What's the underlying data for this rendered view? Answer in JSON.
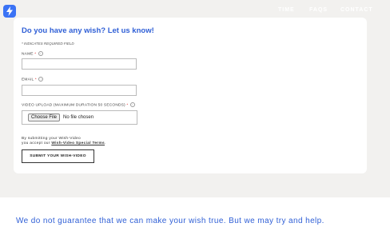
{
  "header": {
    "logo_icon": "lightning-bolt-icon",
    "nav": [
      "TIME",
      "FAQS",
      "CONTACT"
    ]
  },
  "form": {
    "title": "Do you have any wish? Let us know!",
    "required_note": "* INDICATES REQUIRED FIELD",
    "name_label": "NAME",
    "email_label": "EMAIL",
    "video_label": "VIDEO UPLOAD (MAXIMUM DURATION 50 SECONDS)",
    "required_star": "*",
    "info_glyph": "i",
    "name_value": "",
    "email_value": "",
    "choose_file_label": "Choose File",
    "file_status": "No file chosen",
    "terms_line1": "By submitting your Wish-Video",
    "terms_line2": "you accept our",
    "terms_link": "Wish-Video Special Terms",
    "terms_end": ".",
    "submit_label": "SUBMIT YOUR WISH-VIDEO"
  },
  "footer_message": "We do not guarantee that we can make your wish true. But we may try and help.",
  "colors": {
    "accent": "#2f5fd6",
    "logo": "#3b73f5",
    "background": "#f2f1ef"
  }
}
